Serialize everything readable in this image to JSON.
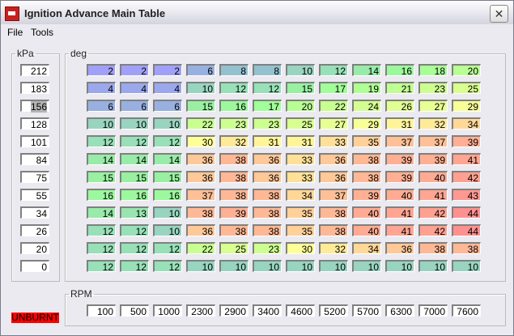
{
  "window": {
    "title": "Ignition Advance Main Table",
    "close_icon": "close-icon"
  },
  "menu": [
    "File",
    "Tools"
  ],
  "kpa_label": "kPa",
  "deg_label": "deg",
  "rpm_label": "RPM",
  "status": "UNBURNT",
  "kpa": [
    "212",
    "183",
    "156",
    "128",
    "101",
    "84",
    "75",
    "55",
    "34",
    "26",
    "20",
    "0"
  ],
  "rpm": [
    "100",
    "500",
    "1000",
    "2300",
    "2900",
    "3400",
    "4600",
    "5200",
    "5700",
    "6300",
    "7000",
    "7600"
  ],
  "table": [
    [
      2,
      2,
      2,
      6,
      8,
      8,
      10,
      12,
      14,
      16,
      18,
      20
    ],
    [
      4,
      4,
      4,
      10,
      12,
      12,
      15,
      17,
      19,
      21,
      23,
      25
    ],
    [
      6,
      6,
      6,
      15,
      16,
      17,
      20,
      22,
      24,
      26,
      27,
      29
    ],
    [
      10,
      10,
      10,
      22,
      23,
      23,
      25,
      27,
      29,
      31,
      32,
      34
    ],
    [
      12,
      12,
      12,
      30,
      32,
      31,
      31,
      33,
      35,
      37,
      37,
      39
    ],
    [
      14,
      14,
      14,
      36,
      38,
      36,
      33,
      36,
      38,
      39,
      39,
      41
    ],
    [
      15,
      15,
      15,
      36,
      38,
      36,
      33,
      36,
      38,
      39,
      40,
      42
    ],
    [
      16,
      16,
      16,
      37,
      38,
      38,
      34,
      37,
      39,
      40,
      41,
      43
    ],
    [
      14,
      13,
      10,
      38,
      39,
      38,
      35,
      38,
      40,
      41,
      42,
      44
    ],
    [
      12,
      12,
      10,
      36,
      38,
      38,
      35,
      38,
      40,
      41,
      42,
      44
    ],
    [
      12,
      12,
      12,
      22,
      25,
      23,
      30,
      32,
      34,
      36,
      38,
      38
    ],
    [
      12,
      12,
      12,
      10,
      10,
      10,
      10,
      10,
      10,
      10,
      10,
      10
    ]
  ],
  "selected_kpa_index": 2
}
